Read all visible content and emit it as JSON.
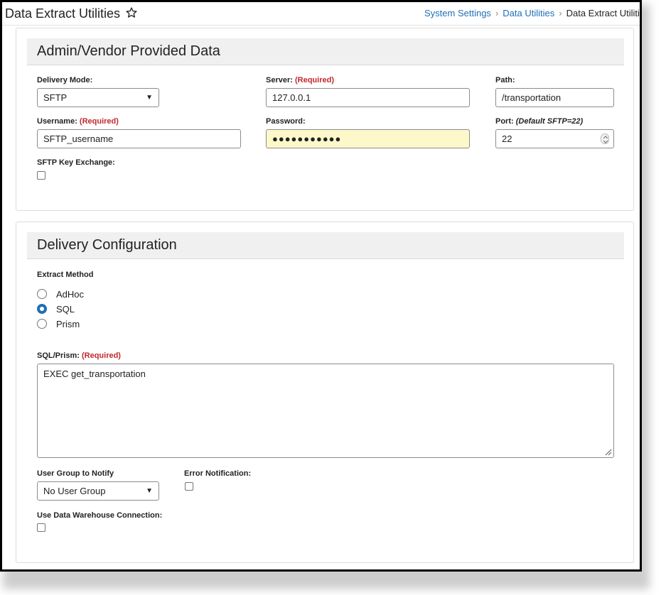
{
  "header": {
    "title": "Data Extract Utilities",
    "breadcrumb": {
      "item1": "System Settings",
      "item2": "Data Utilities",
      "current": "Data Extract Utiliti"
    }
  },
  "vendor_panel": {
    "title": "Admin/Vendor Provided Data",
    "delivery_mode": {
      "label": "Delivery Mode:",
      "value": "SFTP"
    },
    "server": {
      "label": "Server:",
      "required": "(Required)",
      "value": "127.0.0.1"
    },
    "path": {
      "label": "Path:",
      "value": "/transportation"
    },
    "username": {
      "label": "Username:",
      "required": "(Required)",
      "value": "SFTP_username"
    },
    "password": {
      "label": "Password:",
      "value": "●●●●●●●●●●●"
    },
    "port": {
      "label": "Port:",
      "hint": "(Default SFTP=22)",
      "value": "22"
    },
    "key_exchange": {
      "label": "SFTP Key Exchange:",
      "checked": false
    }
  },
  "delivery_panel": {
    "title": "Delivery Configuration",
    "extract_method": {
      "label": "Extract Method",
      "options": [
        "AdHoc",
        "SQL",
        "Prism"
      ],
      "selected": "SQL"
    },
    "sql": {
      "label": "SQL/Prism:",
      "required": "(Required)",
      "value": "EXEC get_transportation"
    },
    "user_group": {
      "label": "User Group to Notify",
      "value": "No User Group"
    },
    "error_notification": {
      "label": "Error Notification:",
      "checked": false
    },
    "data_warehouse": {
      "label": "Use Data Warehouse Connection:",
      "checked": false
    }
  },
  "colors": {
    "link": "#1f6fb5",
    "required": "#c0282d",
    "password_bg": "#fcf8c9",
    "panel_head": "#f0f0f0"
  }
}
